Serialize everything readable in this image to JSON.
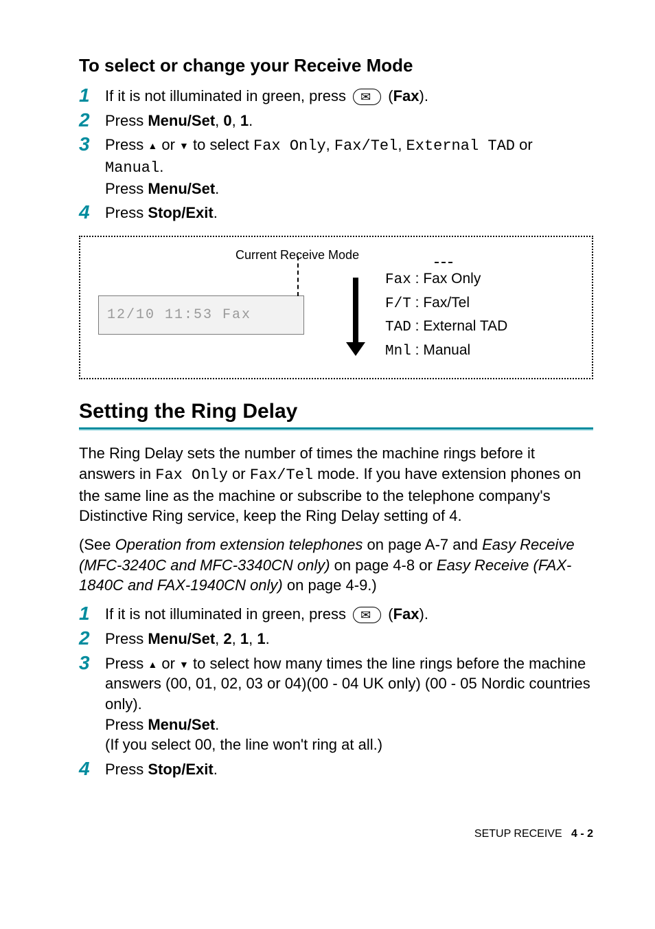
{
  "section_a": {
    "heading": "To select or change your Receive Mode",
    "steps": [
      {
        "num": "1",
        "pre": "If it is not illuminated in green, press ",
        "btn_glyph": "✉",
        "post_open": " (",
        "fax": "Fax",
        "post_close": ")."
      },
      {
        "num": "2",
        "pre": "Press ",
        "b1": "Menu/Set",
        "mid1": ", ",
        "b2": "0",
        "mid2": ", ",
        "b3": "1",
        "end": "."
      },
      {
        "num": "3",
        "pre": "Press ",
        "up": "▲",
        "or": " or ",
        "down": "▼",
        "mid": " to select ",
        "o1": "Fax Only",
        "c1": ", ",
        "o2": "Fax/Tel",
        "c2": ", ",
        "o3": "External TAD",
        "or2": " or ",
        "o4": "Manual",
        "end": ".",
        "line2a": "Press ",
        "line2b": "Menu/Set",
        "line2c": "."
      },
      {
        "num": "4",
        "pre": "Press ",
        "b1": "Stop/Exit",
        "end": "."
      }
    ]
  },
  "diagram": {
    "label": "Current Receive Mode",
    "lcd": "12/10 11:53  Fax",
    "modes": [
      {
        "code": "Fax",
        "name": ": Fax Only"
      },
      {
        "code": "F/T",
        "name": ": Fax/Tel"
      },
      {
        "code": "TAD",
        "name": ": External TAD"
      },
      {
        "code": "Mnl",
        "name": ": Manual"
      }
    ]
  },
  "section_b": {
    "heading": "Setting the Ring Delay",
    "p1a": "The Ring Delay sets the number of times the machine rings before it answers in ",
    "p1m1": "Fax Only",
    "p1b": " or ",
    "p1m2": "Fax/Tel",
    "p1c": " mode. If you have extension phones on the same line as the machine or subscribe to the telephone company's Distinctive Ring service, keep the Ring Delay setting of 4.",
    "p2a": "(See ",
    "p2i1": "Operation from extension telephones",
    "p2b": " on page A-7 and ",
    "p2i2": "Easy Receive (MFC-3240C and MFC-3340CN only)",
    "p2c": " on page 4-8 or ",
    "p2i3": "Easy Receive (FAX-1840C and FAX-1940CN only)",
    "p2d": " on page 4-9.)",
    "steps": [
      {
        "num": "1",
        "pre": "If it is not illuminated in green, press ",
        "btn_glyph": "✉",
        "post_open": " (",
        "fax": "Fax",
        "post_close": ")."
      },
      {
        "num": "2",
        "pre": "Press ",
        "b1": "Menu/Set",
        "m1": ", ",
        "b2": "2",
        "m2": ", ",
        "b3": "1",
        "m3": ", ",
        "b4": "1",
        "end": "."
      },
      {
        "num": "3",
        "pre": "Press ",
        "up": "▲",
        "or": " or ",
        "down": "▼",
        "mid": " to select how many times the line rings before the machine answers (00, 01, 02, 03 or 04)(00 - 04 UK only) (00 - 05 Nordic countries only).",
        "l2a": "Press ",
        "l2b": "Menu/Set",
        "l2c": ".",
        "l3": "(If you select 00, the line won't ring at all.)"
      },
      {
        "num": "4",
        "pre": "Press ",
        "b1": "Stop/Exit",
        "end": "."
      }
    ]
  },
  "footer": {
    "label": "SETUP RECEIVE",
    "page": "4 - 2"
  }
}
